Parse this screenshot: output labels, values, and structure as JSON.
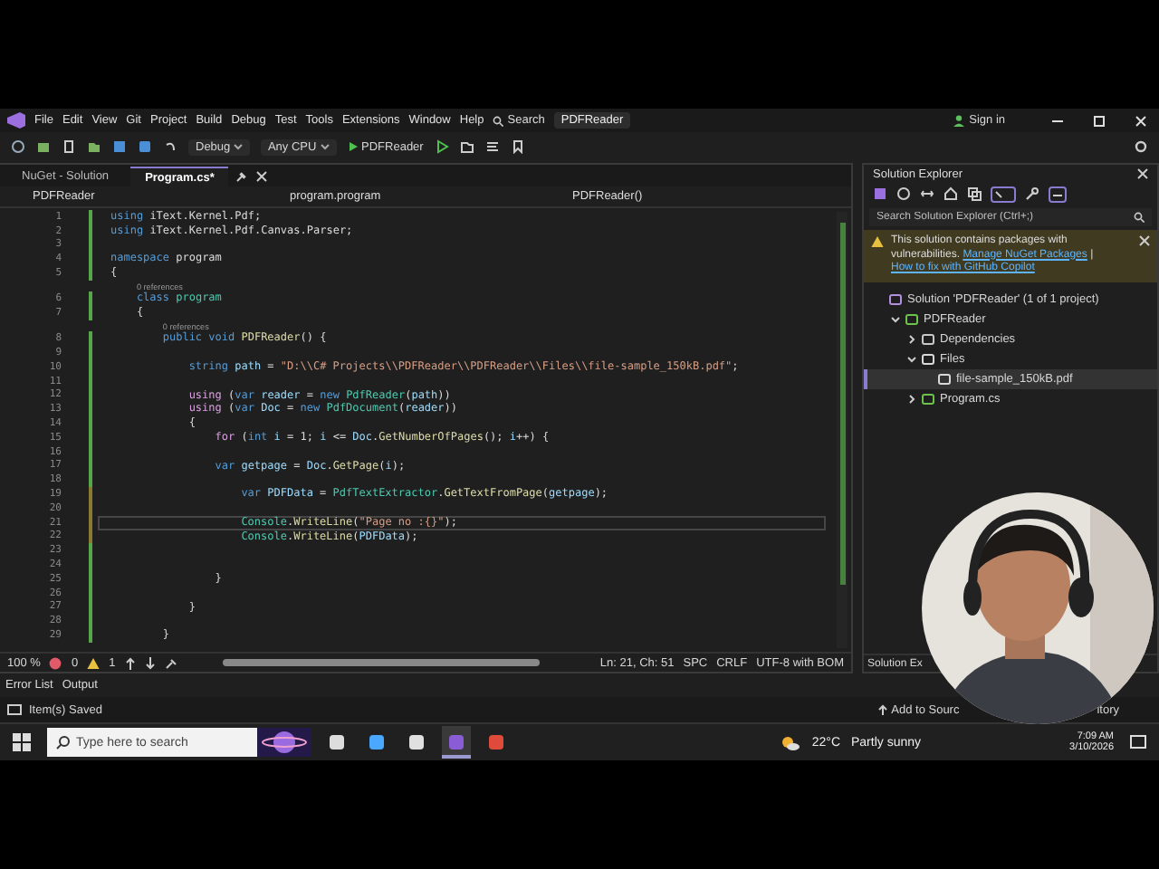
{
  "window": {
    "title": "PDFReader"
  },
  "menu": [
    "File",
    "Edit",
    "View",
    "Git",
    "Project",
    "Build",
    "Debug",
    "Test",
    "Tools",
    "Extensions",
    "Window",
    "Help"
  ],
  "search": "Search",
  "account": "Sign in",
  "toolbar": {
    "configuration": "Debug",
    "platform": "Any CPU",
    "run_target": "PDFReader"
  },
  "tabs": [
    {
      "label": "NuGet - Solution",
      "selected": false
    },
    {
      "label": "Program.cs*",
      "selected": true
    }
  ],
  "nav": [
    "PDFReader",
    "program.program",
    "PDFReader()"
  ],
  "code": [
    {
      "kind": "code",
      "n": "1",
      "current": false,
      "modified": false,
      "tokens": [
        {
          "kind": "kw",
          "text": "using "
        },
        {
          "kind": "plain",
          "text": "iText.Kernel.Pdf;"
        }
      ]
    },
    {
      "kind": "code",
      "n": "2",
      "current": false,
      "modified": false,
      "tokens": [
        {
          "kind": "kw",
          "text": "using "
        },
        {
          "kind": "plain",
          "text": "iText.Kernel.Pdf.Canvas.Parser;"
        }
      ]
    },
    {
      "kind": "code",
      "n": "3",
      "current": false,
      "modified": false
    },
    {
      "kind": "code",
      "n": "4",
      "current": false,
      "modified": false,
      "tokens": [
        {
          "kind": "kw",
          "text": "namespace "
        },
        {
          "kind": "plain",
          "text": "program"
        }
      ]
    },
    {
      "kind": "code",
      "n": "5",
      "current": false,
      "modified": false,
      "tokens": [
        {
          "kind": "plain",
          "text": "{"
        }
      ]
    },
    {
      "kind": "codelens",
      "text": "0 references"
    },
    {
      "kind": "code",
      "n": "6",
      "current": false,
      "modified": false,
      "tokens": [
        {
          "kind": "kw",
          "text": "    class "
        },
        {
          "kind": "type",
          "text": "program"
        }
      ]
    },
    {
      "kind": "code",
      "n": "7",
      "current": false,
      "modified": false,
      "tokens": [
        {
          "kind": "plain",
          "text": "    {"
        }
      ]
    },
    {
      "kind": "codelens",
      "text": "0 references"
    },
    {
      "kind": "code",
      "n": "8",
      "current": false,
      "modified": false,
      "tokens": [
        {
          "kind": "kw",
          "text": "        public void "
        },
        {
          "kind": "fn",
          "text": "PDFReader"
        },
        {
          "kind": "plain",
          "text": "() {"
        }
      ]
    },
    {
      "kind": "code",
      "n": "9",
      "current": false,
      "modified": false
    },
    {
      "kind": "code",
      "n": "10",
      "current": false,
      "modified": false,
      "tokens": [
        {
          "kind": "kw",
          "text": "            string "
        },
        {
          "kind": "var",
          "text": "path"
        },
        {
          "kind": "plain",
          "text": " = "
        },
        {
          "kind": "str",
          "text": "\"D:\\\\C# Projects\\\\PDFReader\\\\PDFReader\\\\Files\\\\file-sample_150kB.pdf\""
        },
        {
          "kind": "plain",
          "text": ";"
        }
      ]
    },
    {
      "kind": "code",
      "n": "11",
      "current": false,
      "modified": false
    },
    {
      "kind": "code",
      "n": "12",
      "current": false,
      "modified": false,
      "tokens": [
        {
          "kind": "ctl",
          "text": "            using "
        },
        {
          "kind": "plain",
          "text": "("
        },
        {
          "kind": "kw",
          "text": "var "
        },
        {
          "kind": "var",
          "text": "reader"
        },
        {
          "kind": "plain",
          "text": " = "
        },
        {
          "kind": "kw",
          "text": "new "
        },
        {
          "kind": "type",
          "text": "PdfReader"
        },
        {
          "kind": "plain",
          "text": "("
        },
        {
          "kind": "var",
          "text": "path"
        },
        {
          "kind": "plain",
          "text": "))"
        }
      ]
    },
    {
      "kind": "code",
      "n": "13",
      "current": false,
      "modified": false,
      "tokens": [
        {
          "kind": "ctl",
          "text": "            using "
        },
        {
          "kind": "plain",
          "text": "("
        },
        {
          "kind": "kw",
          "text": "var "
        },
        {
          "kind": "var",
          "text": "Doc"
        },
        {
          "kind": "plain",
          "text": " = "
        },
        {
          "kind": "kw",
          "text": "new "
        },
        {
          "kind": "type",
          "text": "PdfDocument"
        },
        {
          "kind": "plain",
          "text": "("
        },
        {
          "kind": "var",
          "text": "reader"
        },
        {
          "kind": "plain",
          "text": "))"
        }
      ]
    },
    {
      "kind": "code",
      "n": "14",
      "current": false,
      "modified": false,
      "tokens": [
        {
          "kind": "plain",
          "text": "            {"
        }
      ]
    },
    {
      "kind": "code",
      "n": "15",
      "current": false,
      "modified": false,
      "tokens": [
        {
          "kind": "ctl",
          "text": "                for "
        },
        {
          "kind": "plain",
          "text": "("
        },
        {
          "kind": "kw",
          "text": "int "
        },
        {
          "kind": "var",
          "text": "i"
        },
        {
          "kind": "plain",
          "text": " = 1; "
        },
        {
          "kind": "var",
          "text": "i"
        },
        {
          "kind": "plain",
          "text": " <= "
        },
        {
          "kind": "var",
          "text": "Doc"
        },
        {
          "kind": "plain",
          "text": "."
        },
        {
          "kind": "fn",
          "text": "GetNumberOfPages"
        },
        {
          "kind": "plain",
          "text": "(); "
        },
        {
          "kind": "var",
          "text": "i"
        },
        {
          "kind": "plain",
          "text": "++) {"
        }
      ]
    },
    {
      "kind": "code",
      "n": "16",
      "current": false,
      "modified": false
    },
    {
      "kind": "code",
      "n": "17",
      "current": false,
      "modified": false,
      "tokens": [
        {
          "kind": "kw",
          "text": "                var "
        },
        {
          "kind": "var",
          "text": "getpage"
        },
        {
          "kind": "plain",
          "text": " = "
        },
        {
          "kind": "var",
          "text": "Doc"
        },
        {
          "kind": "plain",
          "text": "."
        },
        {
          "kind": "fn",
          "text": "GetPage"
        },
        {
          "kind": "plain",
          "text": "("
        },
        {
          "kind": "var",
          "text": "i"
        },
        {
          "kind": "plain",
          "text": ");"
        }
      ]
    },
    {
      "kind": "code",
      "n": "18",
      "current": false,
      "modified": false
    },
    {
      "kind": "code",
      "n": "19",
      "current": false,
      "modified": true,
      "tokens": [
        {
          "kind": "kw",
          "text": "                    var "
        },
        {
          "kind": "var",
          "text": "PDFData"
        },
        {
          "kind": "plain",
          "text": " = "
        },
        {
          "kind": "type",
          "text": "PdfTextExtractor"
        },
        {
          "kind": "plain",
          "text": "."
        },
        {
          "kind": "fn",
          "text": "GetTextFromPage"
        },
        {
          "kind": "plain",
          "text": "("
        },
        {
          "kind": "var",
          "text": "getpage"
        },
        {
          "kind": "plain",
          "text": ");"
        }
      ]
    },
    {
      "kind": "code",
      "n": "20",
      "current": false,
      "modified": true
    },
    {
      "kind": "code",
      "n": "21",
      "current": true,
      "modified": true,
      "tokens": [
        {
          "kind": "type",
          "text": "                    Console"
        },
        {
          "kind": "plain",
          "text": "."
        },
        {
          "kind": "fn",
          "text": "WriteLine"
        },
        {
          "kind": "plain",
          "text": "("
        },
        {
          "kind": "str",
          "text": "\"Page no :{}\""
        },
        {
          "kind": "plain",
          "text": ");"
        }
      ]
    },
    {
      "kind": "code",
      "n": "22",
      "current": false,
      "modified": true,
      "tokens": [
        {
          "kind": "type",
          "text": "                    Console"
        },
        {
          "kind": "plain",
          "text": "."
        },
        {
          "kind": "fn",
          "text": "WriteLine"
        },
        {
          "kind": "plain",
          "text": "("
        },
        {
          "kind": "var",
          "text": "PDFData"
        },
        {
          "kind": "plain",
          "text": ");"
        }
      ]
    },
    {
      "kind": "code",
      "n": "23",
      "current": false,
      "modified": false
    },
    {
      "kind": "code",
      "n": "24",
      "current": false,
      "modified": false
    },
    {
      "kind": "code",
      "n": "25",
      "current": false,
      "modified": false,
      "tokens": [
        {
          "kind": "plain",
          "text": "                }"
        }
      ]
    },
    {
      "kind": "code",
      "n": "26",
      "current": false,
      "modified": false
    },
    {
      "kind": "code",
      "n": "27",
      "current": false,
      "modified": false,
      "tokens": [
        {
          "kind": "plain",
          "text": "            }"
        }
      ]
    },
    {
      "kind": "code",
      "n": "28",
      "current": false,
      "modified": false
    },
    {
      "kind": "code",
      "n": "29",
      "current": false,
      "modified": false,
      "tokens": [
        {
          "kind": "plain",
          "text": "        }"
        }
      ]
    }
  ],
  "editor_status": {
    "zoom": "100 %",
    "errors": "0",
    "warnings": "1",
    "position": "Ln: 21, Ch: 51",
    "indent": "SPC",
    "line_endings": "CRLF",
    "encoding": "UTF-8 with BOM"
  },
  "solution_explorer": {
    "title": "Solution Explorer",
    "search": {
      "placeholder": "Search Solution Explorer (Ctrl+;)"
    },
    "banner": {
      "text": "This solution contains packages with vulnerabilities.",
      "links": [
        "Manage NuGet Packages",
        "How to fix with GitHub Copilot"
      ],
      "separator": "|"
    },
    "tree": [
      {
        "kind": "solution",
        "label": "Solution 'PDFReader' (1 of 1 project)",
        "selected": false,
        "children": [
          {
            "kind": "project",
            "label": "PDFReader",
            "selected": false,
            "expanded": true,
            "children": [
              {
                "kind": "dependencies",
                "label": "Dependencies",
                "selected": false,
                "expanded": false
              },
              {
                "kind": "folder",
                "label": "Files",
                "selected": false,
                "expanded": true,
                "children": [
                  {
                    "kind": "file",
                    "label": "file-sample_150kB.pdf",
                    "selected": true
                  }
                ]
              },
              {
                "kind": "csharp",
                "label": "Program.cs",
                "selected": false,
                "expanded": false
              }
            ]
          }
        ]
      }
    ]
  },
  "side_tab": "Solution Ex",
  "bottom_tabs": [
    "Error List",
    "Output"
  ],
  "status_bar": {
    "message": "Item(s) Saved",
    "source_control": "Add to Sourc",
    "repository": "itory"
  },
  "taskbar": {
    "search": {
      "placeholder": "Type here to search"
    },
    "apps": [
      {
        "kind": "taskview",
        "active": false
      },
      {
        "kind": "copilot",
        "active": false
      },
      {
        "kind": "recorder",
        "active": false
      },
      {
        "kind": "visualstudio",
        "active": true
      },
      {
        "kind": "chrome",
        "active": false
      }
    ],
    "weather": {
      "temperature": "22°C",
      "condition": "Partly sunny"
    },
    "time": "7:09 AM",
    "date": "3/10/2026"
  }
}
